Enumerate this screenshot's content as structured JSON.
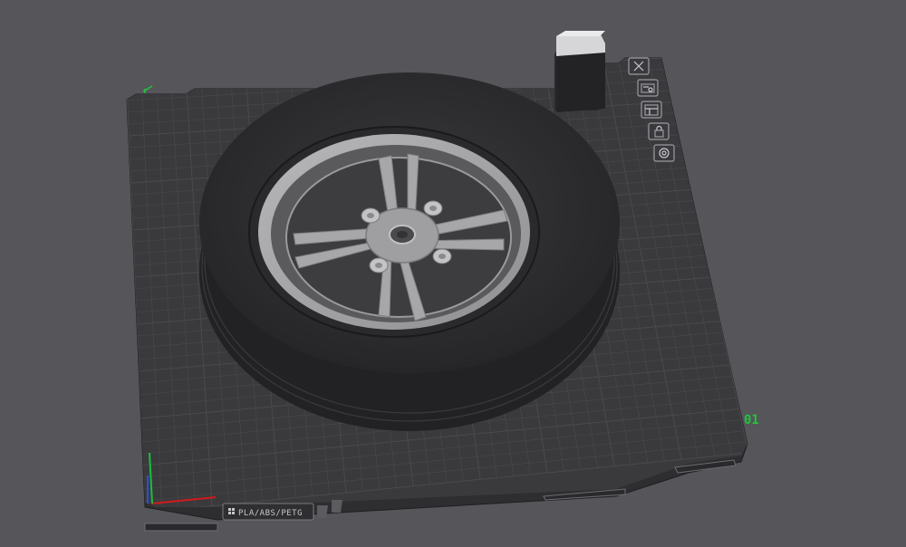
{
  "build_plate": {
    "label": "PLA/ABS/PETG",
    "plate_number": "01"
  },
  "plate_toolbar": {
    "items": [
      {
        "name": "remove-plate",
        "icon": "close-icon"
      },
      {
        "name": "auto-arrange-plate",
        "icon": "arrange-icon"
      },
      {
        "name": "plate-settings",
        "icon": "settings-panel-icon"
      },
      {
        "name": "lock-plate",
        "icon": "lock-icon"
      },
      {
        "name": "orient-plate",
        "icon": "orient-icon"
      }
    ]
  },
  "colors": {
    "background": "#55555a",
    "plate_surface": "#3a3a3d",
    "grid_line": "#4a4a4e",
    "tire": "#2c2c2e",
    "rim": "#a8a8aa",
    "plate_number": "#21c43a",
    "axis_x": "#d01b1b",
    "axis_y": "#1bbf3b",
    "axis_z": "#2a4fd8"
  },
  "scene_objects": [
    {
      "name": "wheel-with-tire",
      "spokes": 4,
      "lug_nuts": 4
    },
    {
      "name": "prime-tower"
    }
  ]
}
